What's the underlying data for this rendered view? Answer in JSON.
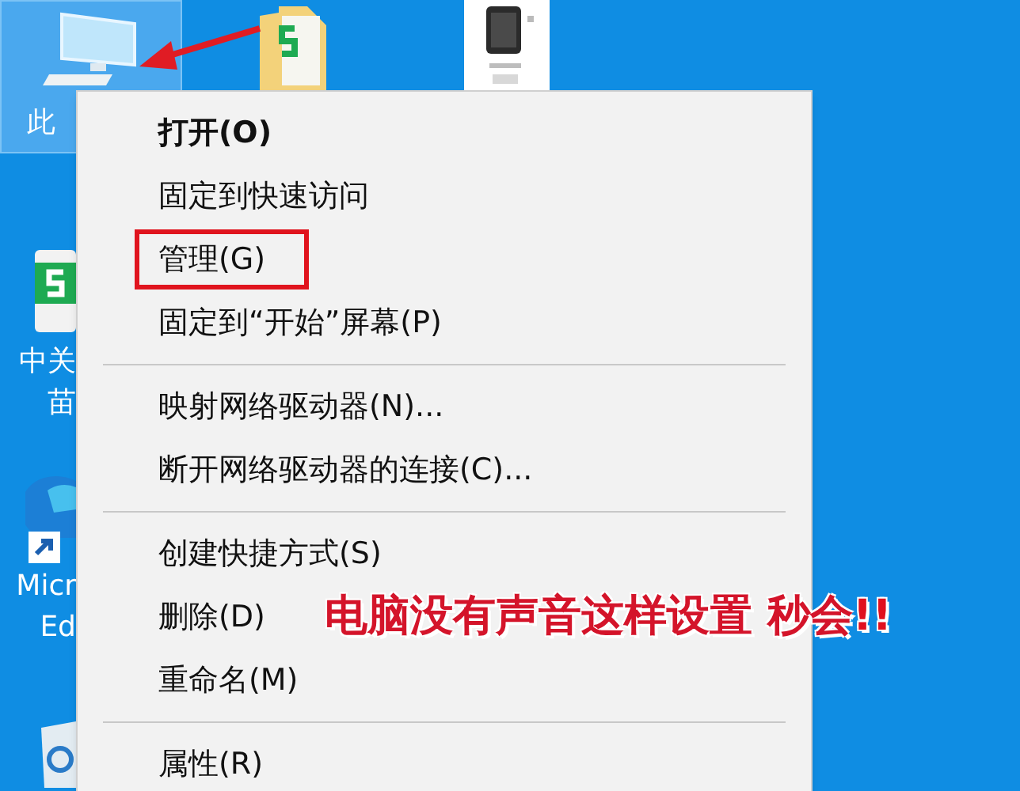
{
  "desktop_icons": [
    {
      "kind": "computer",
      "label": "此",
      "selected": true
    },
    {
      "kind": "sheet",
      "label_lines": [
        "中关",
        "苗"
      ]
    },
    {
      "kind": "browser",
      "label_lines": [
        "Micr",
        "Ed"
      ]
    },
    {
      "kind": "recycle"
    }
  ],
  "context_menu": {
    "items": [
      {
        "kind": "item",
        "label": "打开(O)",
        "default": true,
        "annotated": false
      },
      {
        "kind": "item",
        "label": "固定到快速访问",
        "default": false,
        "annotated": false
      },
      {
        "kind": "item",
        "label": "管理(G)",
        "default": false,
        "annotated": true
      },
      {
        "kind": "item",
        "label": "固定到“开始”屏幕(P)",
        "default": false,
        "annotated": false
      },
      {
        "kind": "separator"
      },
      {
        "kind": "item",
        "label": "映射网络驱动器(N)...",
        "default": false,
        "annotated": false
      },
      {
        "kind": "item",
        "label": "断开网络驱动器的连接(C)...",
        "default": false,
        "annotated": false
      },
      {
        "kind": "separator"
      },
      {
        "kind": "item",
        "label": "创建快捷方式(S)",
        "default": false,
        "annotated": false
      },
      {
        "kind": "item",
        "label": "删除(D)",
        "default": false,
        "annotated": false
      },
      {
        "kind": "item",
        "label": "重命名(M)",
        "default": false,
        "annotated": false
      },
      {
        "kind": "separator"
      },
      {
        "kind": "item",
        "label": "属性(R)",
        "default": false,
        "annotated": false
      }
    ]
  },
  "caption": {
    "text": "电脑没有声音这样设置 秒会",
    "emphasis": "!!"
  }
}
